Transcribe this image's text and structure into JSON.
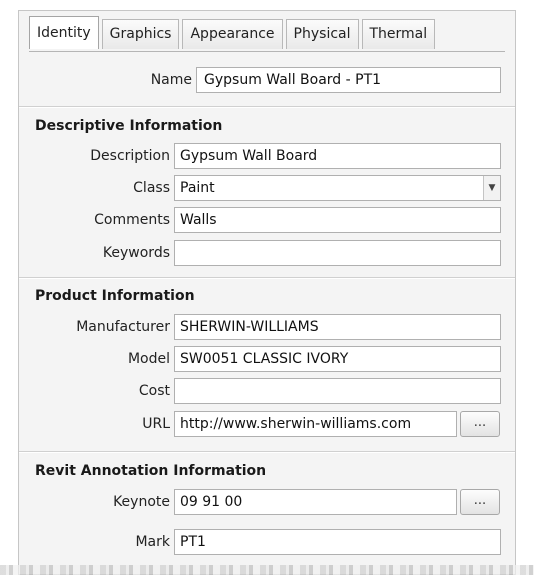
{
  "tabs": [
    {
      "label": "Identity",
      "active": true
    },
    {
      "label": "Graphics",
      "active": false
    },
    {
      "label": "Appearance",
      "active": false
    },
    {
      "label": "Physical",
      "active": false
    },
    {
      "label": "Thermal",
      "active": false
    }
  ],
  "name": {
    "label": "Name",
    "value": "Gypsum Wall Board - PT1"
  },
  "descriptive": {
    "heading": "Descriptive Information",
    "description": {
      "label": "Description",
      "value": "Gypsum Wall Board"
    },
    "class": {
      "label": "Class",
      "value": "Paint",
      "dropdown_icon": "chevron-down-icon"
    },
    "comments": {
      "label": "Comments",
      "value": "Walls"
    },
    "keywords": {
      "label": "Keywords",
      "value": ""
    }
  },
  "product": {
    "heading": "Product Information",
    "manufacturer": {
      "label": "Manufacturer",
      "value": "SHERWIN-WILLIAMS"
    },
    "model": {
      "label": "Model",
      "value": "SW0051 CLASSIC IVORY"
    },
    "cost": {
      "label": "Cost",
      "value": ""
    },
    "url": {
      "label": "URL",
      "value": "http://www.sherwin-williams.com",
      "browse_label": "..."
    }
  },
  "annotation": {
    "heading": "Revit Annotation Information",
    "keynote": {
      "label": "Keynote",
      "value": "09 91 00",
      "browse_label": "..."
    },
    "mark": {
      "label": "Mark",
      "value": "PT1"
    }
  }
}
